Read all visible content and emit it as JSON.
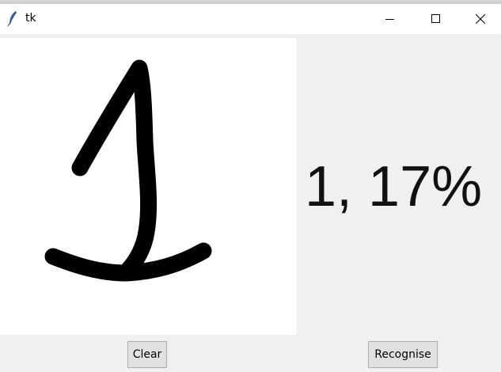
{
  "window": {
    "title": "tk",
    "icon": "feather-icon",
    "controls": [
      "minimize-icon",
      "maximize-icon",
      "close-icon"
    ]
  },
  "canvas": {
    "background": "#ffffff",
    "stroke_color": "#000000",
    "drawn_content": "handwritten digit 1"
  },
  "result": {
    "text": "1, 17%"
  },
  "buttons": {
    "clear_label": "Clear",
    "recognise_label": "Recognise"
  }
}
